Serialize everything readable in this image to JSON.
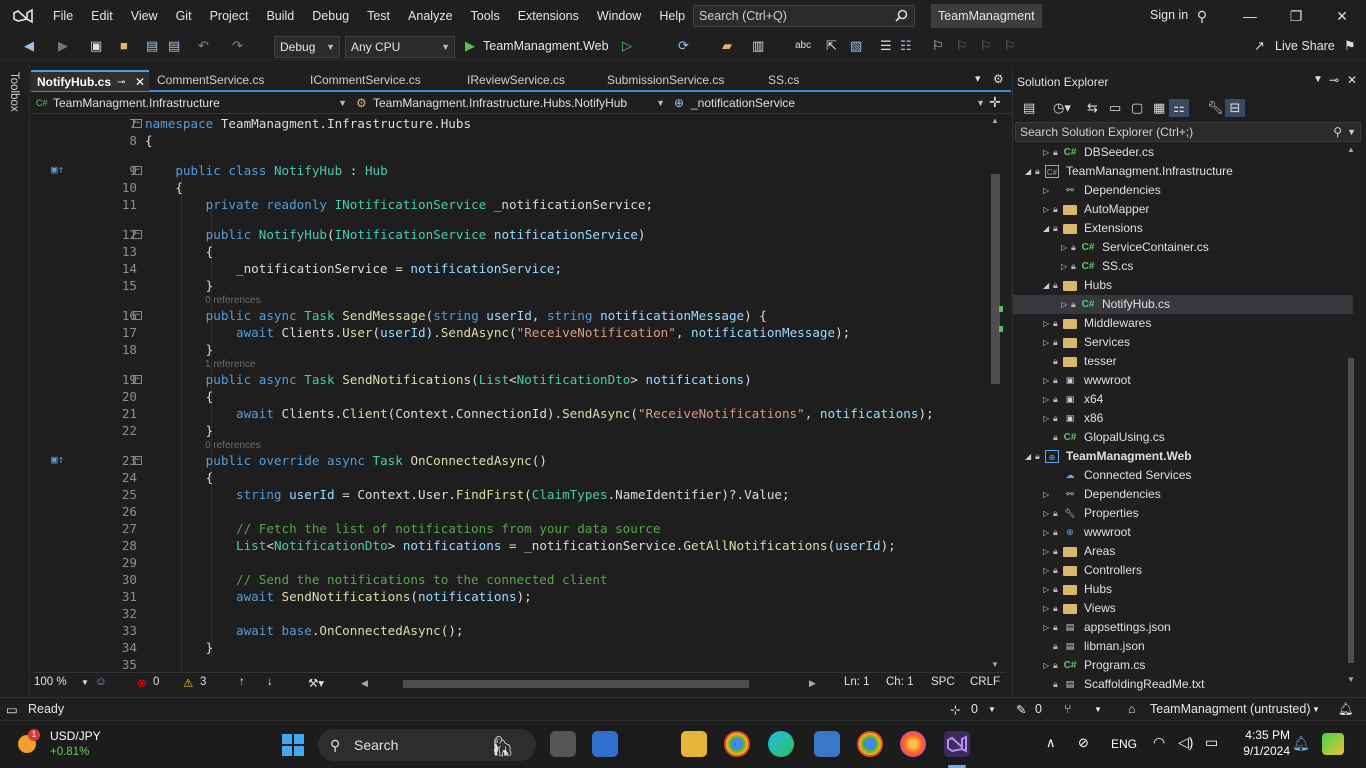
{
  "menubar": {
    "items": [
      "File",
      "Edit",
      "View",
      "Git",
      "Project",
      "Build",
      "Debug",
      "Test",
      "Analyze",
      "Tools",
      "Extensions",
      "Window",
      "Help"
    ],
    "search_placeholder": "Search (Ctrl+Q)",
    "project_title": "TeamManagment",
    "sign_in": "Sign in"
  },
  "toolbar": {
    "config": "Debug",
    "platform": "Any CPU",
    "run_target": "TeamManagment.Web",
    "live_share": "Live Share"
  },
  "toolbox_label": "Toolbox",
  "tabs": [
    {
      "label": "NotifyHub.cs",
      "active": true
    },
    {
      "label": "CommentService.cs"
    },
    {
      "label": "ICommentService.cs"
    },
    {
      "label": "IReviewService.cs"
    },
    {
      "label": "SubmissionService.cs"
    },
    {
      "label": "SS.cs"
    }
  ],
  "navbar": {
    "project": "TeamManagment.Infrastructure",
    "class": "TeamManagment.Infrastructure.Hubs.NotifyHub",
    "member": "_notificationService"
  },
  "code_lines": [
    {
      "n": "7"
    },
    {
      "n": "8"
    },
    {
      "n": "9"
    },
    {
      "n": "10"
    },
    {
      "n": "11"
    },
    {
      "n": "12"
    },
    {
      "n": "13"
    },
    {
      "n": "14"
    },
    {
      "n": "15"
    },
    {
      "n": "16"
    },
    {
      "n": "17"
    },
    {
      "n": "18"
    },
    {
      "n": "19"
    },
    {
      "n": "20"
    },
    {
      "n": "21"
    },
    {
      "n": "22"
    },
    {
      "n": "23"
    },
    {
      "n": "24"
    },
    {
      "n": "25"
    },
    {
      "n": "26"
    },
    {
      "n": "27"
    },
    {
      "n": "28"
    },
    {
      "n": "29"
    },
    {
      "n": "30"
    },
    {
      "n": "31"
    },
    {
      "n": "32"
    },
    {
      "n": "33"
    },
    {
      "n": "34"
    },
    {
      "n": "35"
    }
  ],
  "code_refs": {
    "r1": "0 references",
    "r2": "1 reference",
    "r3": "0 references"
  },
  "editor_status": {
    "zoom": "100 %",
    "errors": "0",
    "warnings": "3",
    "line": "Ln: 1",
    "col": "Ch: 1",
    "spc": "SPC",
    "eol": "CRLF"
  },
  "solution_explorer": {
    "title": "Solution Explorer",
    "search_placeholder": "Search Solution Explorer (Ctrl+;)",
    "items": [
      {
        "label": "DBSeeder.cs"
      },
      {
        "label": "TeamManagment.Infrastructure"
      },
      {
        "label": "Dependencies"
      },
      {
        "label": "AutoMapper"
      },
      {
        "label": "Extensions"
      },
      {
        "label": "ServiceContainer.cs"
      },
      {
        "label": "SS.cs"
      },
      {
        "label": "Hubs"
      },
      {
        "label": "NotifyHub.cs"
      },
      {
        "label": "Middlewares"
      },
      {
        "label": "Services"
      },
      {
        "label": "tesser"
      },
      {
        "label": "wwwroot"
      },
      {
        "label": "x64"
      },
      {
        "label": "x86"
      },
      {
        "label": "GlopalUsing.cs"
      },
      {
        "label": "TeamManagment.Web"
      },
      {
        "label": "Connected Services"
      },
      {
        "label": "Dependencies"
      },
      {
        "label": "Properties"
      },
      {
        "label": "wwwroot"
      },
      {
        "label": "Areas"
      },
      {
        "label": "Controllers"
      },
      {
        "label": "Hubs"
      },
      {
        "label": "Views"
      },
      {
        "label": "appsettings.json"
      },
      {
        "label": "libman.json"
      },
      {
        "label": "Program.cs"
      },
      {
        "label": "ScaffoldingReadMe.txt"
      }
    ]
  },
  "statusbar": {
    "ready": "Ready",
    "up": "0",
    "pencil": "0",
    "repo": "TeamManagment (untrusted)"
  },
  "taskbar": {
    "widget_name": "USD/JPY",
    "widget_value": "+0.81%",
    "widget_badge": "1",
    "search": "Search",
    "lang": "ENG",
    "time": "4:35 PM",
    "date": "9/1/2024"
  },
  "colors": {
    "accent": "#3f8ad8",
    "keyword": "#569cd6",
    "type": "#4ec9b0",
    "string": "#d69d85",
    "comment": "#57a64a"
  }
}
